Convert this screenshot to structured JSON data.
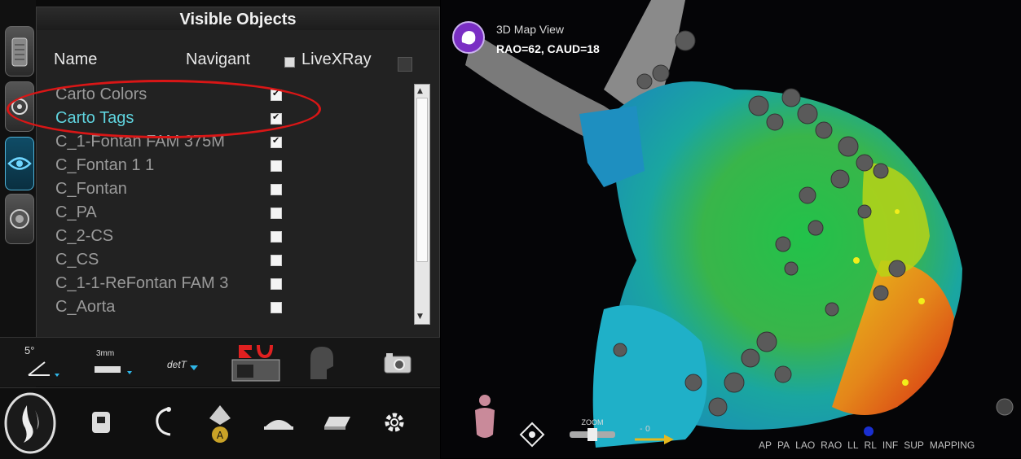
{
  "panel": {
    "title": "Visible Objects",
    "col_name": "Name",
    "col_navigant": "Navigant",
    "col_livexray": "LiveXRay"
  },
  "objects": [
    {
      "name": "Carto Colors",
      "checked": true,
      "highlight": false
    },
    {
      "name": "Carto Tags",
      "checked": true,
      "highlight": true
    },
    {
      "name": "C_1-Fontan FAM 375M",
      "checked": true,
      "highlight": false
    },
    {
      "name": "C_Fontan 1 1",
      "checked": false,
      "highlight": false
    },
    {
      "name": "C_Fontan",
      "checked": false,
      "highlight": false
    },
    {
      "name": "C_PA",
      "checked": false,
      "highlight": false
    },
    {
      "name": "C_2-CS",
      "checked": false,
      "highlight": false
    },
    {
      "name": "C_CS",
      "checked": false,
      "highlight": false
    },
    {
      "name": "C_1-1-ReFontan FAM 3",
      "checked": false,
      "highlight": false
    },
    {
      "name": "C_Aorta",
      "checked": false,
      "highlight": false
    }
  ],
  "toolbar1": {
    "angle_label": "5°",
    "distance_label": "3mm",
    "det_label": "detT"
  },
  "view": {
    "title": "3D Map View",
    "angle": "RAO=62, CAUD=18",
    "zoom_label": "ZOOM",
    "buttons": [
      "AP",
      "PA",
      "LAO",
      "RAO",
      "LL",
      "RL",
      "INF",
      "SUP",
      "MAPPING"
    ]
  },
  "colors": {
    "accent": "#5fd3de",
    "highlight_ring": "#d91616",
    "view_badge": "#7a2fc4"
  }
}
